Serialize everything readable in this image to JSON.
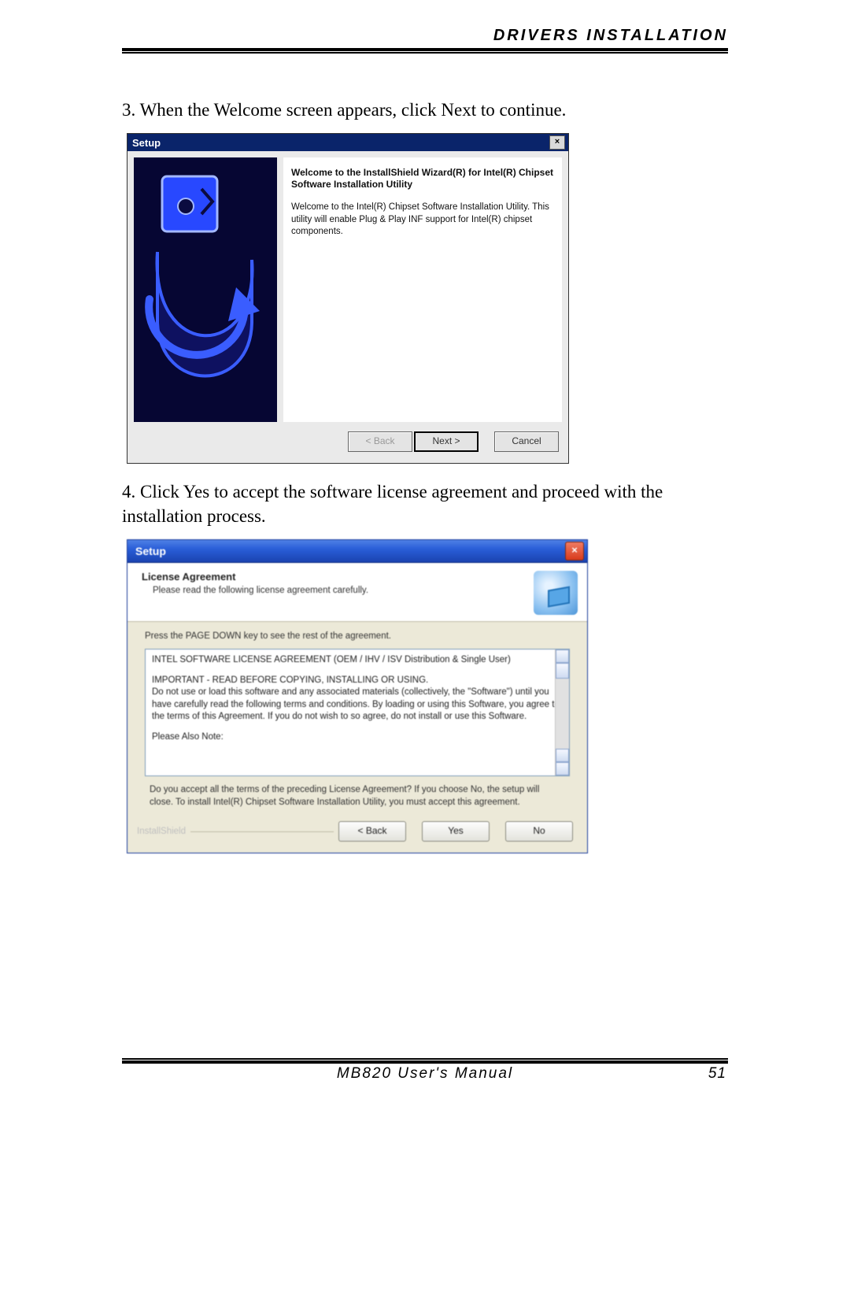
{
  "page": {
    "header": "DRIVERS INSTALLATION",
    "step3": "3. When the Welcome screen appears, click Next to continue.",
    "step4": "4. Click Yes to accept the software license agreement and proceed with the installation process.",
    "footer_center": "MB820 User's Manual",
    "footer_right": "51"
  },
  "ss1": {
    "title": "Setup",
    "heading": "Welcome to the InstallShield Wizard(R) for Intel(R) Chipset Software Installation Utility",
    "paragraph": "Welcome to the Intel(R) Chipset Software Installation Utility. This utility will enable Plug & Play INF support for Intel(R) chipset components.",
    "buttons": {
      "back": "< Back",
      "next": "Next >",
      "cancel": "Cancel"
    }
  },
  "ss2": {
    "title": "Setup",
    "header_title": "License Agreement",
    "header_sub": "Please read the following license agreement carefully.",
    "hint": "Press the PAGE DOWN key to see the rest of the agreement.",
    "license_line1": "INTEL SOFTWARE LICENSE AGREEMENT (OEM / IHV / ISV Distribution & Single User)",
    "license_line2": "IMPORTANT - READ BEFORE COPYING, INSTALLING OR USING.",
    "license_line3": "Do not use or load this software and any associated materials (collectively, the \"Software\") until you have carefully read the following terms and conditions. By loading or using this Software, you agree to the terms of this Agreement. If you do not wish to so agree, do not install or use this Software.",
    "license_line4": "Please Also Note:",
    "question": "Do you accept all the terms of the preceding License Agreement? If you choose No, the setup will close. To install Intel(R) Chipset Software Installation Utility, you must accept this agreement.",
    "brand": "InstallShield",
    "buttons": {
      "back": "< Back",
      "yes": "Yes",
      "no": "No"
    }
  }
}
